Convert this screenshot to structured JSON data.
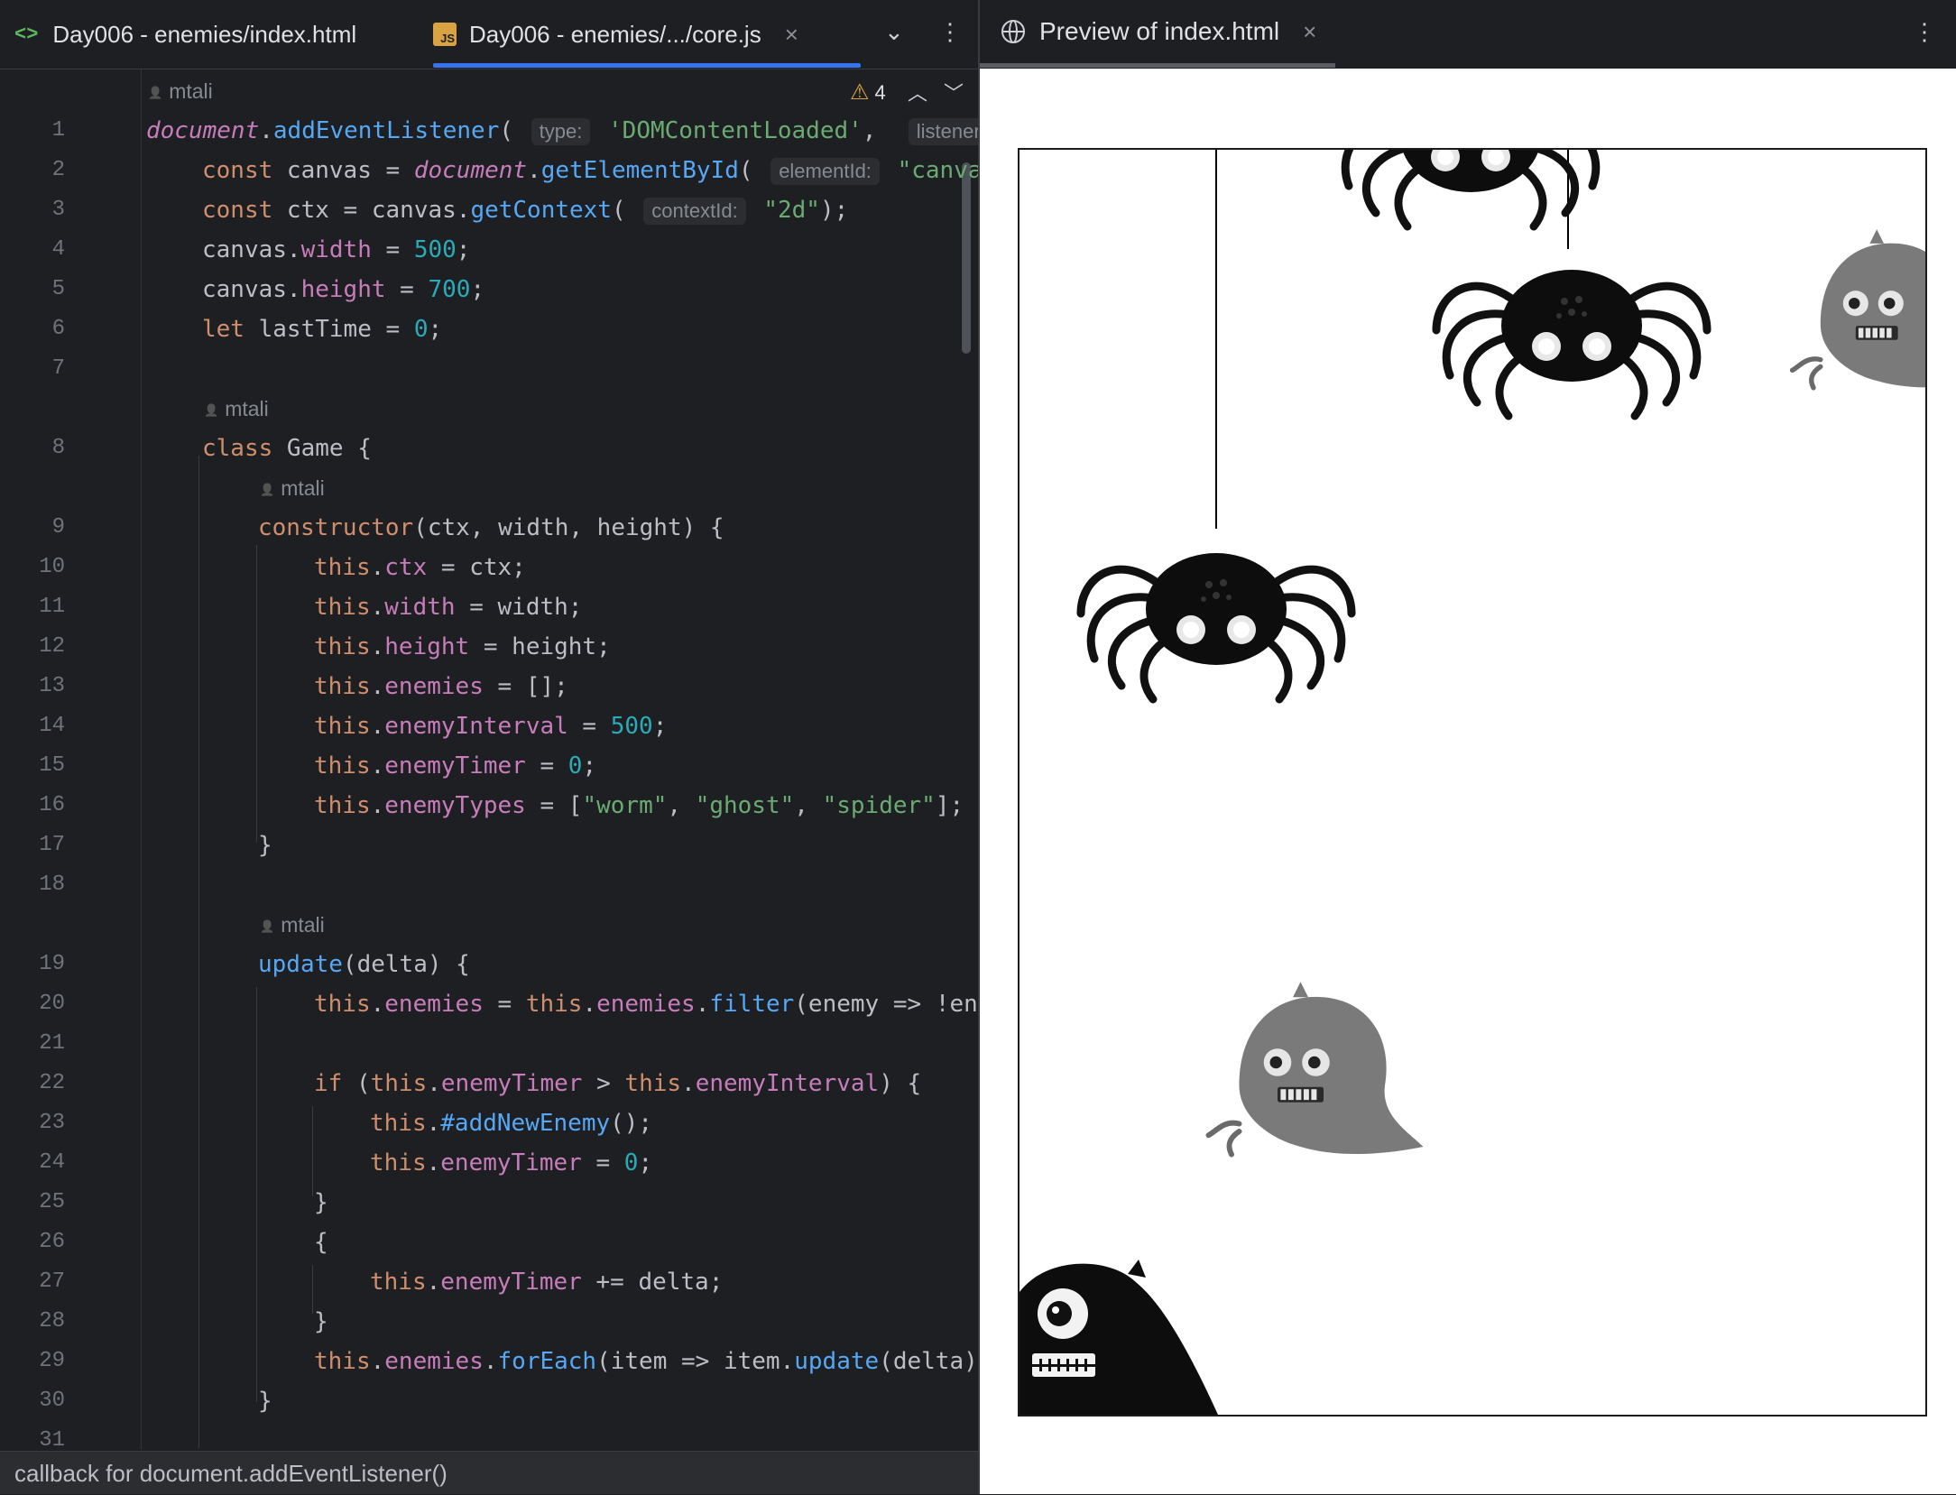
{
  "tabs": [
    {
      "label": "Day006 - enemies/index.html",
      "icon": "html-icon"
    },
    {
      "label": "Day006 - enemies/.../core.js",
      "icon": "js-icon",
      "badge": "JS",
      "active": true
    }
  ],
  "preview_tab": {
    "label": "Preview of index.html",
    "icon": "globe-icon"
  },
  "inspections": {
    "warnings": "4"
  },
  "author": "mtali",
  "line_numbers": [
    "1",
    "2",
    "3",
    "4",
    "5",
    "6",
    "7",
    "8",
    "9",
    "10",
    "11",
    "12",
    "13",
    "14",
    "15",
    "16",
    "17",
    "18",
    "19",
    "20",
    "21",
    "22",
    "23",
    "24",
    "25",
    "26",
    "27",
    "28",
    "29",
    "30",
    "31"
  ],
  "code": [
    {
      "ln": "1",
      "text": "document.addEventListener( type: 'DOMContentLoaded',  listener:"
    },
    {
      "ln": "2",
      "text": "const canvas = document.getElementById( elementId: \"canvas"
    },
    {
      "ln": "3",
      "text": "const ctx = canvas.getContext( contextId: \"2d\");"
    },
    {
      "ln": "4",
      "text": "canvas.width = 500;"
    },
    {
      "ln": "5",
      "text": "canvas.height = 700;"
    },
    {
      "ln": "6",
      "text": "let lastTime = 0;"
    },
    {
      "ln": "8",
      "text": "class Game {"
    },
    {
      "ln": "9",
      "text": "constructor(ctx, width, height) {"
    },
    {
      "ln": "10",
      "text": "this.ctx = ctx;"
    },
    {
      "ln": "11",
      "text": "this.width = width;"
    },
    {
      "ln": "12",
      "text": "this.height = height;"
    },
    {
      "ln": "13",
      "text": "this.enemies = [];"
    },
    {
      "ln": "14",
      "text": "this.enemyInterval = 500;"
    },
    {
      "ln": "15",
      "text": "this.enemyTimer = 0;"
    },
    {
      "ln": "16",
      "text": "this.enemyTypes = [\"worm\", \"ghost\", \"spider\"];"
    },
    {
      "ln": "17",
      "text": "}"
    },
    {
      "ln": "19",
      "text": "update(delta) {"
    },
    {
      "ln": "20",
      "text": "this.enemies = this.enemies.filter(enemy => !en"
    },
    {
      "ln": "22",
      "text": "if (this.enemyTimer > this.enemyInterval) {"
    },
    {
      "ln": "23",
      "text": "this.#addNewEnemy();"
    },
    {
      "ln": "24",
      "text": "this.enemyTimer = 0;"
    },
    {
      "ln": "25",
      "text": "}"
    },
    {
      "ln": "26",
      "text": "{"
    },
    {
      "ln": "27",
      "text": "this.enemyTimer += delta;"
    },
    {
      "ln": "28",
      "text": "}"
    },
    {
      "ln": "29",
      "text": "this.enemies.forEach(item => item.update(delta)"
    },
    {
      "ln": "30",
      "text": "}"
    }
  ],
  "status_bar": "callback for document.addEventListener()",
  "preview": {
    "sprites": [
      "spider",
      "spider",
      "spider",
      "ghost",
      "ghost",
      "worm"
    ]
  },
  "colors": {
    "editor_bg": "#1e1f22",
    "accent": "#3574f0",
    "keyword": "#cf8e6d",
    "function": "#56a8f5",
    "string": "#6aab73",
    "number": "#2aacb8",
    "property": "#c77dbb"
  }
}
